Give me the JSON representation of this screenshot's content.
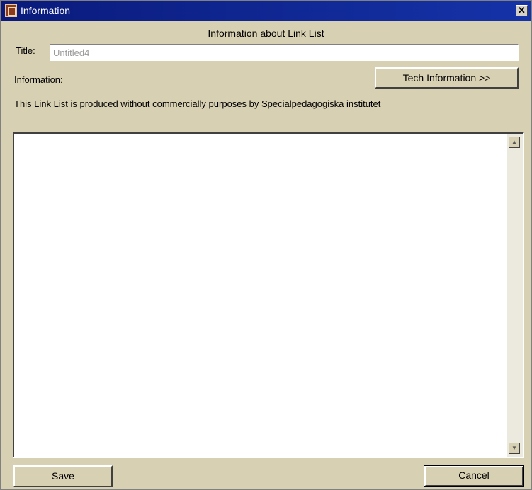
{
  "window": {
    "title": "Information",
    "close_symbol": "✕"
  },
  "dialog": {
    "heading": "Information about Link List",
    "title_label": "Title:",
    "title_value": "Untitled4",
    "info_label": "Information:",
    "tech_button": "Tech Information >>",
    "description": "This Link List is produced without commercially purposes by Specialpedagogiska institutet",
    "save_button": "Save",
    "cancel_button": "Cancel"
  },
  "icons": {
    "app": "app-icon",
    "close": "close-icon",
    "scroll_up": "scroll-up-arrow-icon",
    "scroll_down": "scroll-down-arrow-icon"
  }
}
